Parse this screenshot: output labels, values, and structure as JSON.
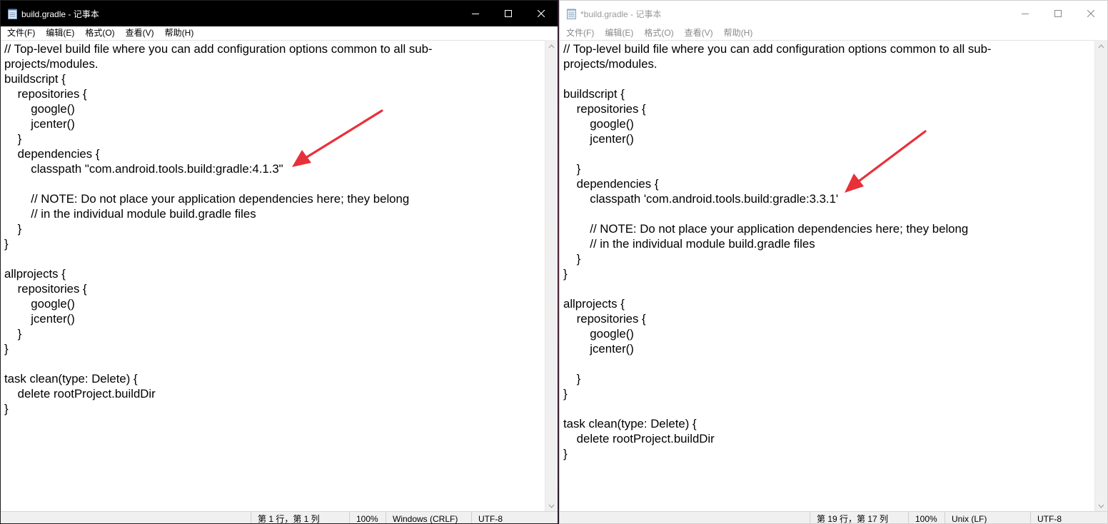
{
  "left_window": {
    "title": "build.gradle - 记事本",
    "menu": [
      "文件(F)",
      "编辑(E)",
      "格式(O)",
      "查看(V)",
      "帮助(H)"
    ],
    "code": "// Top-level build file where you can add configuration options common to all sub-\nprojects/modules.\nbuildscript {\n    repositories {\n        google()\n        jcenter()\n    }\n    dependencies {\n        classpath \"com.android.tools.build:gradle:4.1.3\"\n\n        // NOTE: Do not place your application dependencies here; they belong\n        // in the individual module build.gradle files\n    }\n}\n\nallprojects {\n    repositories {\n        google()\n        jcenter()\n    }\n}\n\ntask clean(type: Delete) {\n    delete rootProject.buildDir\n}",
    "status": {
      "position": "第 1 行，第 1 列",
      "zoom": "100%",
      "line_ending": "Windows (CRLF)",
      "encoding": "UTF-8"
    },
    "annotation_color": "#e8303a"
  },
  "right_window": {
    "title": "*build.gradle - 记事本",
    "menu": [
      "文件(F)",
      "编辑(E)",
      "格式(O)",
      "查看(V)",
      "帮助(H)"
    ],
    "code": "// Top-level build file where you can add configuration options common to all sub-\nprojects/modules.\n\nbuildscript {\n    repositories {\n        google()\n        jcenter()\n\n    }\n    dependencies {\n        classpath 'com.android.tools.build:gradle:3.3.1'\n\n        // NOTE: Do not place your application dependencies here; they belong\n        // in the individual module build.gradle files\n    }\n}\n\nallprojects {\n    repositories {\n        google()\n        jcenter()\n\n    }\n}\n\ntask clean(type: Delete) {\n    delete rootProject.buildDir\n}",
    "status": {
      "position": "第 19 行，第 17 列",
      "zoom": "100%",
      "line_ending": "Unix (LF)",
      "encoding": "UTF-8"
    },
    "annotation_color": "#e8303a"
  },
  "icons": {
    "app": "notepad-icon",
    "minimize": "minimize-icon",
    "maximize": "maximize-icon",
    "close": "close-icon"
  }
}
